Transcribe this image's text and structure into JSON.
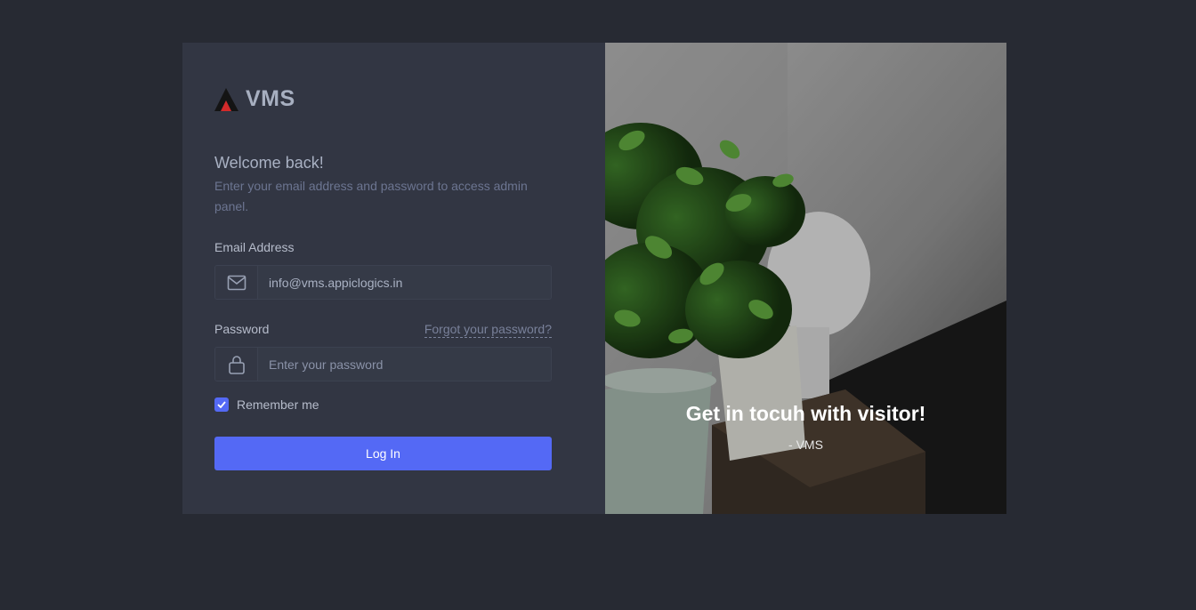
{
  "brand": {
    "name": "VMS",
    "logo_icon": "vms-logo-icon"
  },
  "login": {
    "title": "Welcome back!",
    "subtitle": "Enter your email address and password to access admin panel.",
    "email_label": "Email Address",
    "email_value": "info@vms.appiclogics.in",
    "email_icon": "mail-icon",
    "password_label": "Password",
    "forgot_link": "Forgot your password?",
    "password_placeholder": "Enter your password",
    "password_icon": "lock-icon",
    "remember_label": "Remember me",
    "remember_checked": true,
    "submit_label": "Log In"
  },
  "hero": {
    "quote": "Get in tocuh with visitor!",
    "author": "- VMS"
  },
  "colors": {
    "background": "#272a33",
    "card": "#323643",
    "accent": "#5469f5"
  }
}
